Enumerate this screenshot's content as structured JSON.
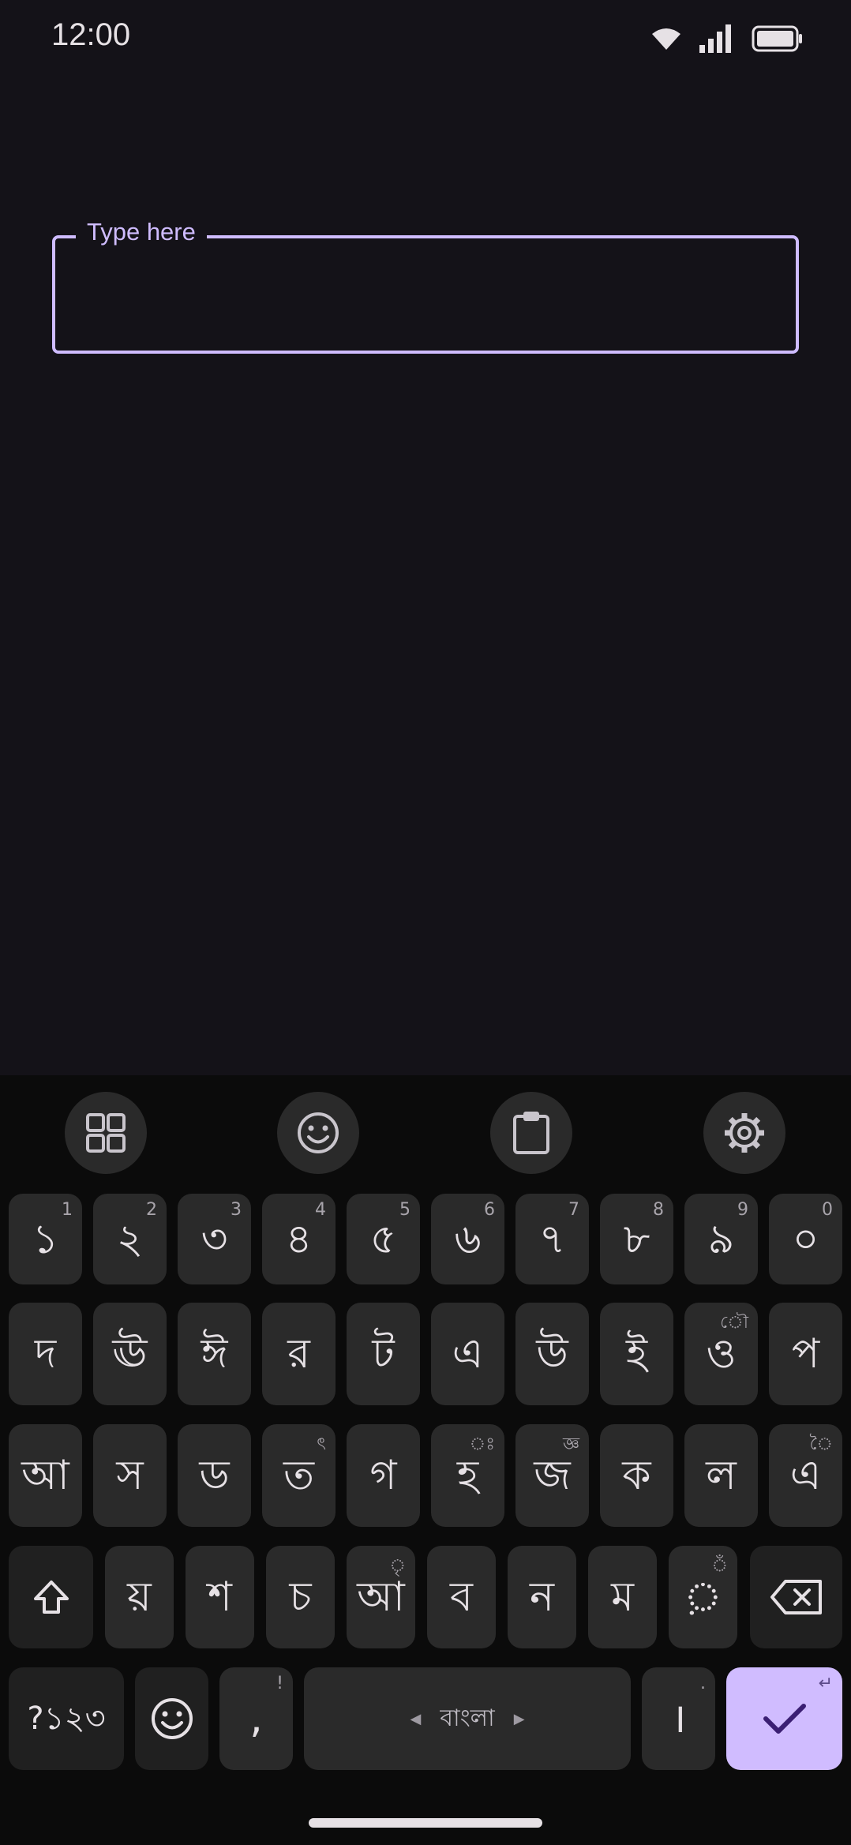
{
  "status_bar": {
    "time": "12:00"
  },
  "text_field": {
    "label": "Type here",
    "value": ""
  },
  "keyboard": {
    "toolbar": [
      "apps-grid-icon",
      "emoji-icon",
      "clipboard-icon",
      "settings-gear-icon"
    ],
    "row1": [
      {
        "main": "১",
        "hint": "1"
      },
      {
        "main": "২",
        "hint": "2"
      },
      {
        "main": "৩",
        "hint": "3"
      },
      {
        "main": "৪",
        "hint": "4"
      },
      {
        "main": "৫",
        "hint": "5"
      },
      {
        "main": "৬",
        "hint": "6"
      },
      {
        "main": "৭",
        "hint": "7"
      },
      {
        "main": "৮",
        "hint": "8"
      },
      {
        "main": "৯",
        "hint": "9"
      },
      {
        "main": "০",
        "hint": "0"
      }
    ],
    "row2": [
      {
        "main": "দ",
        "hint": ""
      },
      {
        "main": "ঊ",
        "hint": ""
      },
      {
        "main": "ঈ",
        "hint": ""
      },
      {
        "main": "র",
        "hint": ""
      },
      {
        "main": "ট",
        "hint": ""
      },
      {
        "main": "এ",
        "hint": ""
      },
      {
        "main": "উ",
        "hint": ""
      },
      {
        "main": "ই",
        "hint": ""
      },
      {
        "main": "ও",
        "hint": "ৌ"
      },
      {
        "main": "প",
        "hint": ""
      }
    ],
    "row3": [
      {
        "main": "আ",
        "hint": ""
      },
      {
        "main": "স",
        "hint": ""
      },
      {
        "main": "ড",
        "hint": ""
      },
      {
        "main": "ত",
        "hint": "ৎ"
      },
      {
        "main": "গ",
        "hint": ""
      },
      {
        "main": "হ",
        "hint": "ঃ"
      },
      {
        "main": "জ",
        "hint": "জ্ঞ"
      },
      {
        "main": "ক",
        "hint": ""
      },
      {
        "main": "ল",
        "hint": ""
      },
      {
        "main": "এ",
        "hint": "ৈ"
      }
    ],
    "row4": [
      {
        "main": "য়",
        "hint": ""
      },
      {
        "main": "শ",
        "hint": ""
      },
      {
        "main": "চ",
        "hint": ""
      },
      {
        "main": "আ",
        "hint": "ৃ"
      },
      {
        "main": "ব",
        "hint": ""
      },
      {
        "main": "ন",
        "hint": ""
      },
      {
        "main": "ম",
        "hint": ""
      },
      {
        "main": "়",
        "hint": "ঁ"
      }
    ],
    "symbols_label": "?১২৩",
    "comma": {
      "main": ",",
      "hint": "!"
    },
    "space_label": "বাংলা",
    "danda": {
      "main": "।",
      "hint": "."
    },
    "enter_hint": "↵"
  }
}
